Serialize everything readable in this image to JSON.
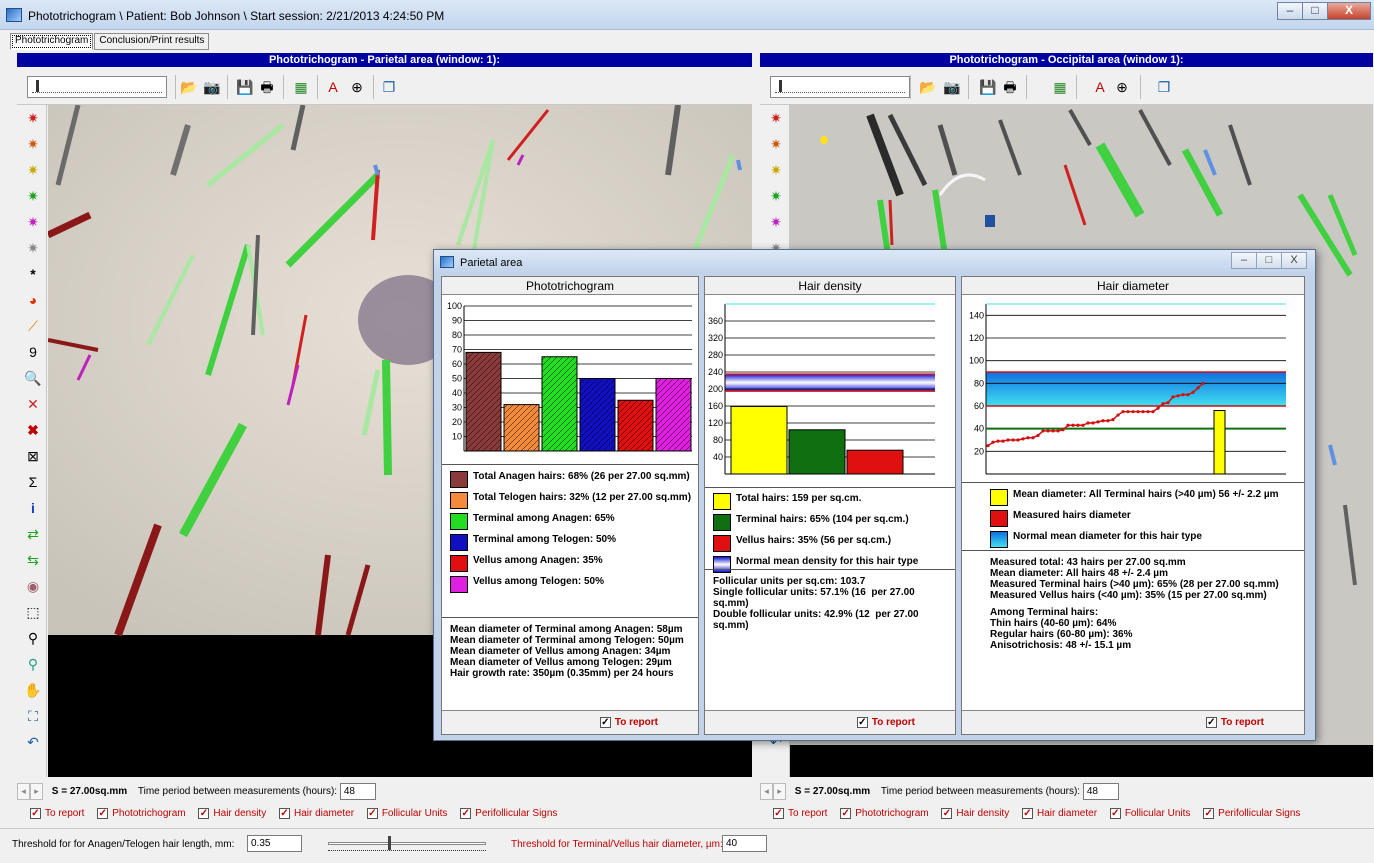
{
  "window": {
    "title": "Phototrichogram  \\ Patient: Bob Johnson \\ Start session: 2/21/2013 4:24:50 PM",
    "min": "–",
    "max": "□",
    "close": "X"
  },
  "tabs": [
    "Phototrichogram",
    "Conclusion/Print results"
  ],
  "left_pane": {
    "header": "Phototrichogram - Parietal area (window: 1):",
    "area_label": "S = 27.00sq.mm",
    "period_label": "Time period between measurements (hours):",
    "period_value": "48"
  },
  "right_pane": {
    "header": "Phototrichogram - Occipital area (window 1):",
    "area_label": "S = 27.00sq.mm",
    "period_label": "Time period between measurements (hours):",
    "period_value": "48"
  },
  "checkboxes": [
    "To report",
    "Phototrichogram",
    "Hair density",
    "Hair diameter",
    "Follicular Units",
    "Perifollicular Signs"
  ],
  "threshold": {
    "anagen_label": "Threshold for for Anagen/Telogen hair length, mm:",
    "anagen_value": "0.35",
    "terminal_label": "Threshold for Terminal/Vellus hair diameter, µm:",
    "terminal_value": "40"
  },
  "dialog": {
    "title": "Parietal area",
    "to_report": "To report",
    "phototrichogram": {
      "header": "Phototrichogram",
      "legend": [
        {
          "color": "#8b3a3a",
          "text": "Total Anagen hairs: 68% (26 per 27.00 sq.mm)"
        },
        {
          "color": "#f58a3c",
          "text": "Total Telogen hairs: 32% (12 per 27.00 sq.mm)"
        },
        {
          "color": "#22dd22",
          "text": "Terminal among Anagen: 65%"
        },
        {
          "color": "#1010c0",
          "text": "Terminal among Telogen: 50%"
        },
        {
          "color": "#e01010",
          "text": "Vellus among Anagen: 35%"
        },
        {
          "color": "#e020e0",
          "text": "Vellus among Telogen: 50%"
        }
      ],
      "stats": [
        "Mean diameter of Terminal among Anagen: 58µm",
        "Mean diameter of Terminal among Telogen: 50µm",
        "Mean diameter of Vellus among Anagen: 34µm",
        "Mean diameter of Vellus among Telogen: 29µm",
        "Hair growth rate: 350µm (0.35mm) per 24 hours"
      ]
    },
    "density": {
      "header": "Hair density",
      "legend": [
        {
          "color": "#ffff00",
          "text": "Total hairs: 159 per sq.cm."
        },
        {
          "color": "#107010",
          "text": "Terminal hairs: 65% (104 per sq.cm.)"
        },
        {
          "color": "#e01010",
          "text": "Vellus hairs: 35% (56 per sq.cm.)"
        },
        {
          "color": "#6060ff",
          "text": "Normal mean density for this hair type"
        }
      ],
      "stats": [
        "Follicular units per sq.cm: 103.7",
        "Single follicular units: 57.1% (16  per 27.00 sq.mm)",
        "Double follicular units: 42.9% (12  per 27.00 sq.mm)"
      ]
    },
    "diameter": {
      "header": "Hair diameter",
      "legend": [
        {
          "color": "#ffff00",
          "text": "Mean diameter: All Terminal hairs (>40 µm) 56 +/- 2.2 µm"
        },
        {
          "color": "#e01010",
          "text": "Measured hairs diameter"
        },
        {
          "color": "#20a0ff",
          "text": "Normal mean diameter for this hair type"
        }
      ],
      "stats": [
        "Measured total: 43 hairs per 27.00 sq.mm",
        "Mean diameter: All hairs 48 +/- 2.4 µm",
        "Measured Terminal hairs (>40 µm): 65% (28 per 27.00 sq.mm)",
        "Measured Vellus hairs (<40 µm): 35% (15 per 27.00 sq.mm)",
        "",
        "Among Terminal hairs:",
        "Thin hairs (40-60 µm): 64%",
        "Regular hairs (60-80 µm): 36%",
        "Anisotrichosis: 48 +/- 15.1 µm"
      ]
    }
  },
  "chart_data": [
    {
      "type": "bar",
      "title": "Phototrichogram",
      "categories": [
        "Total Anagen",
        "Total Telogen",
        "Terminal among Anagen",
        "Terminal among Telogen",
        "Vellus among Anagen",
        "Vellus among Telogen"
      ],
      "values": [
        68,
        32,
        65,
        50,
        35,
        50
      ],
      "colors": [
        "#8b3a3a",
        "#f58a3c",
        "#22dd22",
        "#1010c0",
        "#e01010",
        "#e020e0"
      ],
      "ylim": [
        0,
        100
      ],
      "yticks": [
        10,
        20,
        30,
        40,
        50,
        60,
        70,
        80,
        90,
        100
      ]
    },
    {
      "type": "bar",
      "title": "Hair density",
      "categories": [
        "Total hairs",
        "Terminal hairs",
        "Vellus hairs"
      ],
      "values": [
        159,
        104,
        56
      ],
      "colors": [
        "#ffff00",
        "#107010",
        "#e01010"
      ],
      "normal_band": [
        195,
        235
      ],
      "ylim": [
        0,
        400
      ],
      "yticks": [
        40,
        80,
        120,
        160,
        200,
        240,
        280,
        320,
        360
      ]
    },
    {
      "type": "line",
      "title": "Hair diameter",
      "measured_series": [
        25,
        28,
        29,
        29,
        30,
        30,
        30,
        31,
        32,
        32,
        34,
        38,
        38,
        38,
        38,
        39,
        43,
        43,
        43,
        43,
        45,
        45,
        46,
        47,
        47,
        48,
        52,
        55,
        55,
        55,
        55,
        55,
        55,
        55,
        58,
        62,
        63,
        68,
        69,
        70,
        70,
        72,
        76,
        80
      ],
      "mean_terminal": 56,
      "normal_band": [
        60,
        90
      ],
      "threshold_line": 40,
      "ylim": [
        0,
        150
      ],
      "yticks": [
        20,
        40,
        60,
        80,
        100,
        120,
        140
      ]
    }
  ]
}
